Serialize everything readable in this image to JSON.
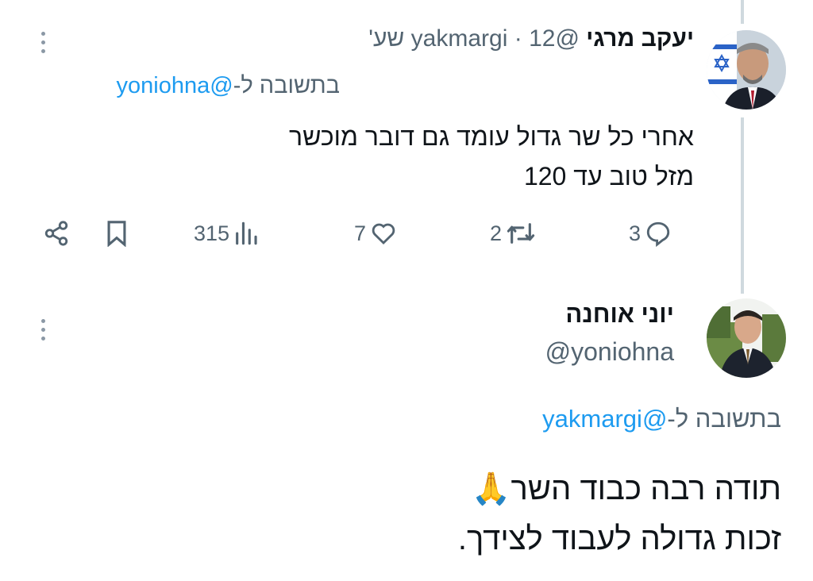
{
  "tweet1": {
    "display_name": "יעקב מרגי",
    "handle": "@yakmargi",
    "separator": "·",
    "time": "12 שע'",
    "reply_prefix": "בתשובה ל-",
    "reply_to": "@yoniohna",
    "body_line1": "אחרי כל שר גדול עומד גם דובר מוכשר",
    "body_line2": "מזל טוב עד 120",
    "stats": {
      "replies": "3",
      "retweets": "2",
      "likes": "7",
      "views": "315"
    }
  },
  "tweet2": {
    "display_name": "יוני אוחנה",
    "handle": "@yoniohna",
    "reply_prefix": "בתשובה ל-",
    "reply_to": "@yakmargi",
    "body_line1": "תודה רבה כבוד השר🙏",
    "body_line2": "זכות גדולה לעבוד לצידך."
  },
  "icons": {
    "more": "more-vertical-icon",
    "reply": "reply-icon",
    "retweet": "retweet-icon",
    "like": "heart-icon",
    "views": "views-icon",
    "bookmark": "bookmark-icon",
    "share": "share-icon"
  },
  "colors": {
    "link": "#1d9bf0",
    "muted": "#536471",
    "thread_line": "#cfd9de"
  }
}
